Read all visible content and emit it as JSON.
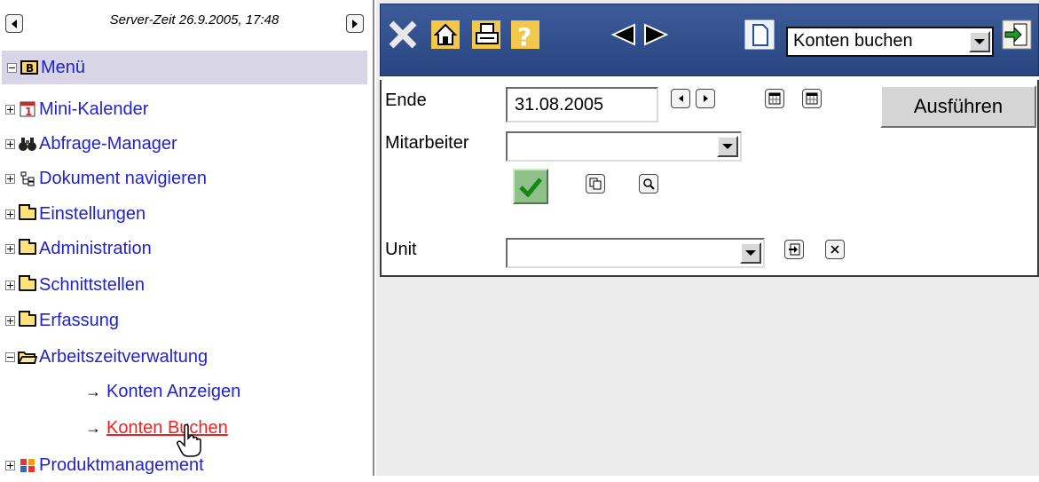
{
  "left_panel": {
    "server_time": "Server-Zeit 26.9.2005, 17:48",
    "menu_label": "Menü",
    "items": [
      {
        "label": "Mini-Kalender",
        "expander": "plus",
        "icon": "calendar-icon"
      },
      {
        "label": "Abfrage-Manager",
        "expander": "plus",
        "icon": "binoculars-icon"
      },
      {
        "label": "Dokument navigieren",
        "expander": "plus",
        "icon": "tree-icon"
      },
      {
        "label": "Einstellungen",
        "expander": "plus",
        "icon": "folder-icon"
      },
      {
        "label": "Administration",
        "expander": "plus",
        "icon": "folder-icon"
      },
      {
        "label": "Schnittstellen",
        "expander": "plus",
        "icon": "folder-icon"
      },
      {
        "label": "Erfassung",
        "expander": "plus",
        "icon": "folder-icon"
      },
      {
        "label": "Arbeitszeitverwaltung",
        "expander": "minus",
        "icon": "open-folder-icon"
      }
    ],
    "subitems": [
      {
        "label": "Konten Anzeigen"
      },
      {
        "label": "Konten Buchen"
      }
    ],
    "last_item": {
      "label": "Produktmanagement",
      "icon": "puzzle-icon"
    }
  },
  "toolbar": {
    "select_value": "Konten buchen"
  },
  "form": {
    "ende_label": "Ende",
    "ende_value": "31.08.2005",
    "mitarbeiter_label": "Mitarbeiter",
    "mitarbeiter_value": "",
    "unit_label": "Unit",
    "unit_value": "",
    "run_button": "Ausführen"
  },
  "colors": {
    "link": "#2222cc",
    "active_link": "#ee2222",
    "menu_bg": "#d8d6e6",
    "toolbar_bg": "#274580"
  }
}
